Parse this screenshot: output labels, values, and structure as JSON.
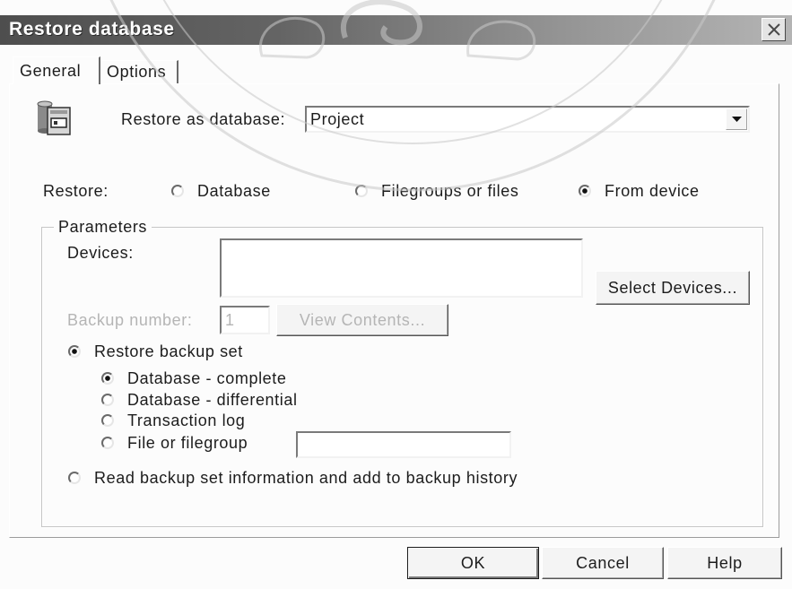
{
  "window": {
    "title": "Restore database",
    "close_icon": "close-icon"
  },
  "tabs": [
    {
      "label": "General",
      "selected": true
    },
    {
      "label": "Options",
      "selected": false
    }
  ],
  "restore_as": {
    "icon": "database-restore-icon",
    "label": "Restore as database:",
    "value": "Project"
  },
  "restore": {
    "label": "Restore:",
    "options": [
      {
        "label": "Database",
        "checked": false
      },
      {
        "label": "Filegroups or files",
        "checked": false
      },
      {
        "label": "From device",
        "checked": true
      }
    ]
  },
  "parameters": {
    "legend": "Parameters",
    "devices": {
      "label": "Devices:",
      "items": []
    },
    "select_devices_label": "Select Devices...",
    "backup_number": {
      "label": "Backup number:",
      "value": "1",
      "enabled": false
    },
    "view_contents": {
      "label": "View Contents...",
      "enabled": false
    },
    "restore_backup_set": {
      "label": "Restore backup set",
      "checked": true,
      "options": [
        {
          "label": "Database - complete",
          "checked": true
        },
        {
          "label": "Database - differential",
          "checked": false
        },
        {
          "label": "Transaction log",
          "checked": false
        },
        {
          "label": "File or filegroup",
          "checked": false
        }
      ],
      "file_or_filegroup_value": ""
    },
    "read_backup_info": {
      "label": "Read backup set information and add to backup history",
      "checked": false
    }
  },
  "buttons": {
    "ok": "OK",
    "cancel": "Cancel",
    "help": "Help"
  },
  "icons": {
    "dropdown": "chevron-down-icon",
    "watermark": "watermark-seal"
  },
  "colors": {
    "titlebar_start": "#4e4e4e",
    "titlebar_end": "#b4b4b4",
    "disabled_text": "#b5b5b5",
    "face": "#f4f4f4"
  }
}
